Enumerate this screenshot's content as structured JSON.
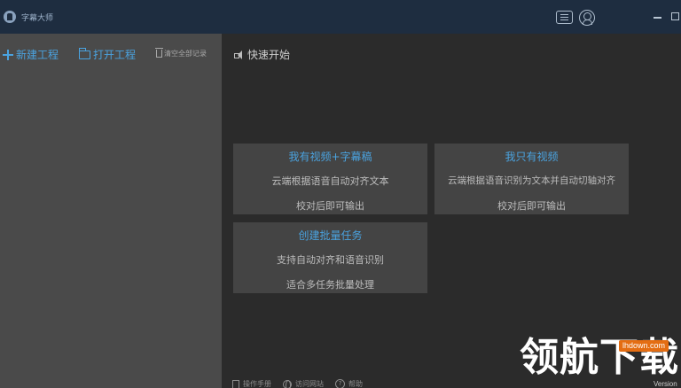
{
  "app": {
    "title": "字幕大师"
  },
  "sidebar": {
    "new_project": "新建工程",
    "open_project": "打开工程",
    "clear_records": "清空全部记录"
  },
  "main": {
    "quick_start": "快速开始",
    "cards": [
      {
        "title": "我有视频+字幕稿",
        "line1": "云端根据语音自动对齐文本",
        "line2": "校对后即可输出"
      },
      {
        "title": "我只有视频",
        "line1": "云端根据语音识别为文本并自动切轴对齐",
        "line2": "校对后即可输出"
      },
      {
        "title": "创建批量任务",
        "line1": "支持自动对齐和语音识别",
        "line2": "适合多任务批量处理"
      }
    ],
    "footer": {
      "manual": "操作手册",
      "website": "访问网站",
      "help": "帮助"
    }
  },
  "watermark": {
    "text": "领航下载",
    "site": "lhdown.com",
    "version": "Version"
  },
  "colors": {
    "accent": "#4aa3e0",
    "titlebar": "#1e2d40",
    "sidebar": "#4a4a4a",
    "card": "#444444"
  }
}
